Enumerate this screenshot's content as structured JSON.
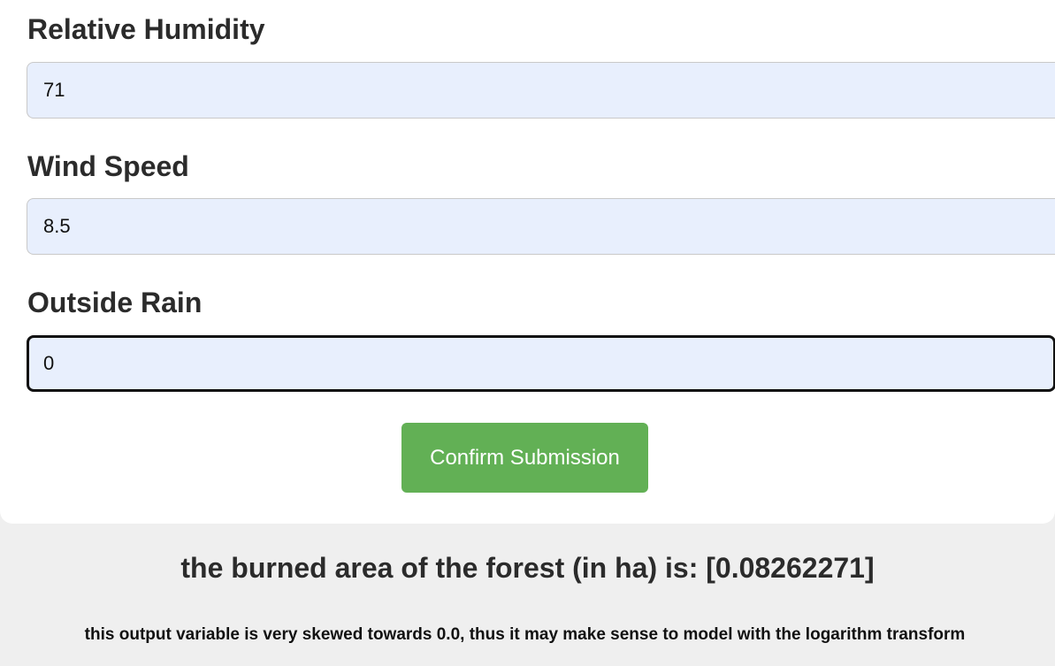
{
  "form": {
    "fields": [
      {
        "label": "Relative Humidity",
        "value": "71"
      },
      {
        "label": "Wind Speed",
        "value": "8.5"
      },
      {
        "label": "Outside Rain",
        "value": "0"
      }
    ],
    "submit_label": "Confirm Submission"
  },
  "result": {
    "text": "the burned area of the forest (in ha) is: [0.08262271]",
    "note": "this output variable is very skewed towards 0.0, thus it may make sense to model with the logarithm transform"
  },
  "colors": {
    "input_background": "#e8effd",
    "submit_button": "#62b055",
    "page_background": "#efefef"
  }
}
